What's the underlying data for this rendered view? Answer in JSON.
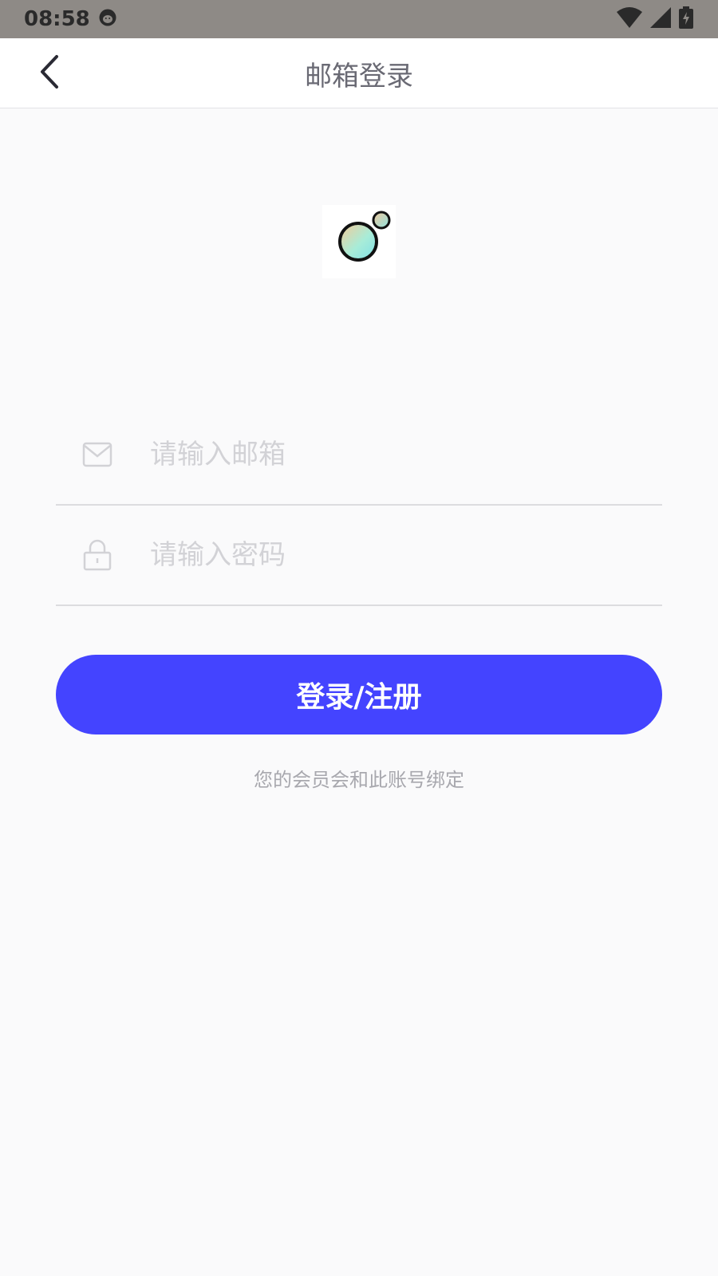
{
  "status_bar": {
    "time": "08:58"
  },
  "app_bar": {
    "title": "邮箱登录"
  },
  "form": {
    "email_placeholder": "请输入邮箱",
    "password_placeholder": "请输入密码",
    "submit_label": "登录/注册",
    "hint": "您的会员会和此账号绑定"
  },
  "icons": {
    "back": "chevron-left-icon",
    "email": "envelope-icon",
    "password": "lock-icon",
    "logo": "bubbles-logo-icon"
  },
  "colors": {
    "accent": "#4444ff",
    "status_bar": "#8e8a86"
  }
}
